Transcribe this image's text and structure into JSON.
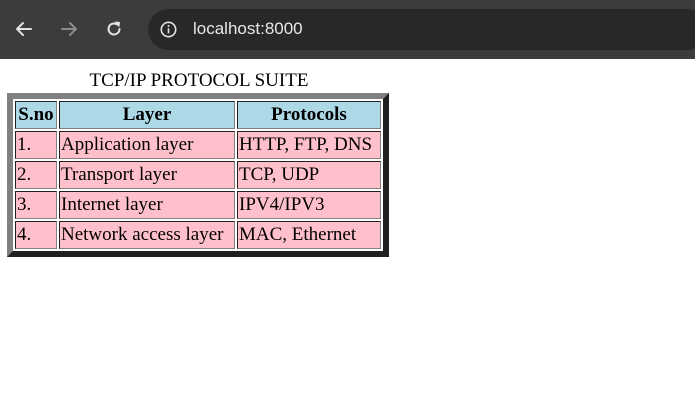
{
  "browser": {
    "url": "localhost:8000",
    "icons": {
      "back": "arrow-left-icon",
      "forward": "arrow-right-icon",
      "reload": "reload-icon",
      "info": "info-icon"
    },
    "colors": {
      "toolbar": "#3c3c3c",
      "address_bar": "#282828"
    }
  },
  "page": {
    "caption": "TCP/IP PROTOCOL SUITE",
    "table": {
      "headers": [
        "S.no",
        "Layer",
        "Protocols"
      ],
      "rows": [
        [
          "1.",
          "Application layer",
          "HTTP, FTP, DNS"
        ],
        [
          "2.",
          "Transport layer",
          "TCP, UDP"
        ],
        [
          "3.",
          "Internet layer",
          "IPV4/IPV3"
        ],
        [
          "4.",
          "Network access layer",
          "MAC, Ethernet"
        ]
      ],
      "colors": {
        "header_bg": "#add8e6",
        "cell_bg": "#ffc0cb"
      }
    }
  }
}
